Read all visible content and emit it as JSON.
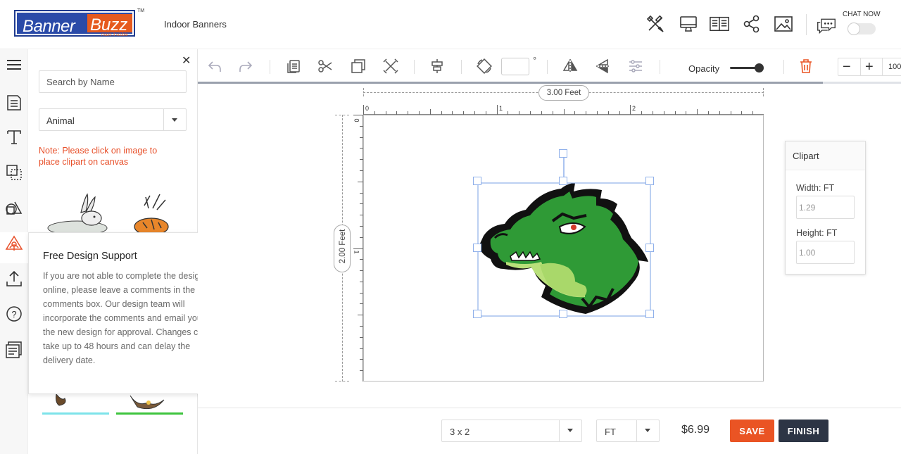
{
  "header": {
    "logo_word_1": "Banner",
    "logo_word_2": "Buzz",
    "logo_tagline": "make it visible",
    "logo_tm": "TM",
    "product_name": "Indoor Banners",
    "chat_label": "CHAT NOW",
    "icons": [
      "design-tools-icon",
      "desktop-preview-icon",
      "book-icon",
      "share-icon",
      "image-icon",
      "chat-icon"
    ]
  },
  "rail": {
    "icons": [
      "menu-icon",
      "templates-icon",
      "text-icon",
      "background-icon",
      "shapes-icon",
      "clipart-icon",
      "upload-icon",
      "help-icon",
      "notes-icon"
    ],
    "active": "clipart-icon"
  },
  "panel": {
    "search_placeholder": "Search by Name",
    "category_value": "Animal",
    "note": "Note: Please click on image to place clipart on canvas"
  },
  "support": {
    "title": "Free Design Support",
    "body": "If you are not able to complete the design online, please leave a comments in the comments box. Our design team will incorporate the comments and email you the new design for approval. Changes can take up to 48 hours and can delay the delivery date."
  },
  "toolbar": {
    "degree_symbol": "°",
    "opacity_label": "Opacity",
    "opacity_value": 1.0,
    "zoom_value": "100",
    "zoom_minus": "−",
    "zoom_plus": "+"
  },
  "canvas": {
    "width_label": "3.00 Feet",
    "height_label": "2.00 Feet",
    "ruler_x": [
      "0",
      "1",
      "2"
    ],
    "ruler_y": [
      "0",
      "1"
    ]
  },
  "props": {
    "title": "Clipart",
    "width_label": "Width: FT",
    "width_value": "1.29",
    "height_label": "Height: FT",
    "height_value": "1.00"
  },
  "bottom": {
    "size_value": "3 x 2",
    "unit_value": "FT",
    "price": "$6.99",
    "save_label": "SAVE",
    "finish_label": "FINISH"
  },
  "colors": {
    "brand_blue": "#2a4aa8",
    "brand_orange": "#e65a1e",
    "save": "#ea5424",
    "finish": "#2d3545",
    "note": "#e8502a"
  }
}
